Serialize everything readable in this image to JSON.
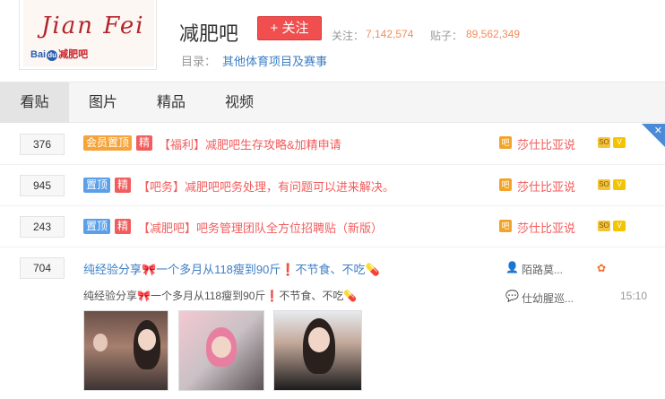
{
  "forum": {
    "logo_script": "Jian Fei",
    "logo_baidu": "Bai",
    "logo_paw": "du",
    "logo_bar": "减肥吧",
    "name": "减肥吧",
    "follow_label": "+ 关注",
    "follow_count_label": "关注：",
    "follow_count": "7,142,574",
    "post_count_label": "贴子：",
    "post_count": "89,562,349",
    "directory_label": "目录：",
    "directory_value": "其他体育项目及赛事"
  },
  "tabs": [
    {
      "label": "看贴",
      "active": true
    },
    {
      "label": "图片",
      "active": false
    },
    {
      "label": "精品",
      "active": false
    },
    {
      "label": "视频",
      "active": false
    }
  ],
  "threads": [
    {
      "replies": "376",
      "tags": [
        "会员置顶",
        "精"
      ],
      "title": "【福利】减肥吧生存攻略&加精申请",
      "author": "莎仕比亚说"
    },
    {
      "replies": "945",
      "tags": [
        "置顶",
        "精"
      ],
      "title": "【吧务】减肥吧吧务处理，有问题可以进来解决。",
      "author": "莎仕比亚说"
    },
    {
      "replies": "243",
      "tags": [
        "置顶",
        "精"
      ],
      "title": "【减肥吧】吧务管理团队全方位招聘贴（新版）",
      "author": "莎仕比亚说"
    }
  ],
  "featured": {
    "replies": "704",
    "title": "纯经验分享🎀一个多月从118瘦到90斤❗不节食、不吃💊",
    "abstract": "纯经验分享🎀一个多月从118瘦到90斤❗不节食、不吃💊",
    "author": "陌路莫...",
    "last_replier": "仕幼腥巡...",
    "time": "15:10"
  },
  "colors": {
    "accent_red": "#f25c5c",
    "link_blue": "#3d7ec6",
    "stat_orange": "#f58c5c",
    "tab_bg": "#f5f5f5"
  }
}
